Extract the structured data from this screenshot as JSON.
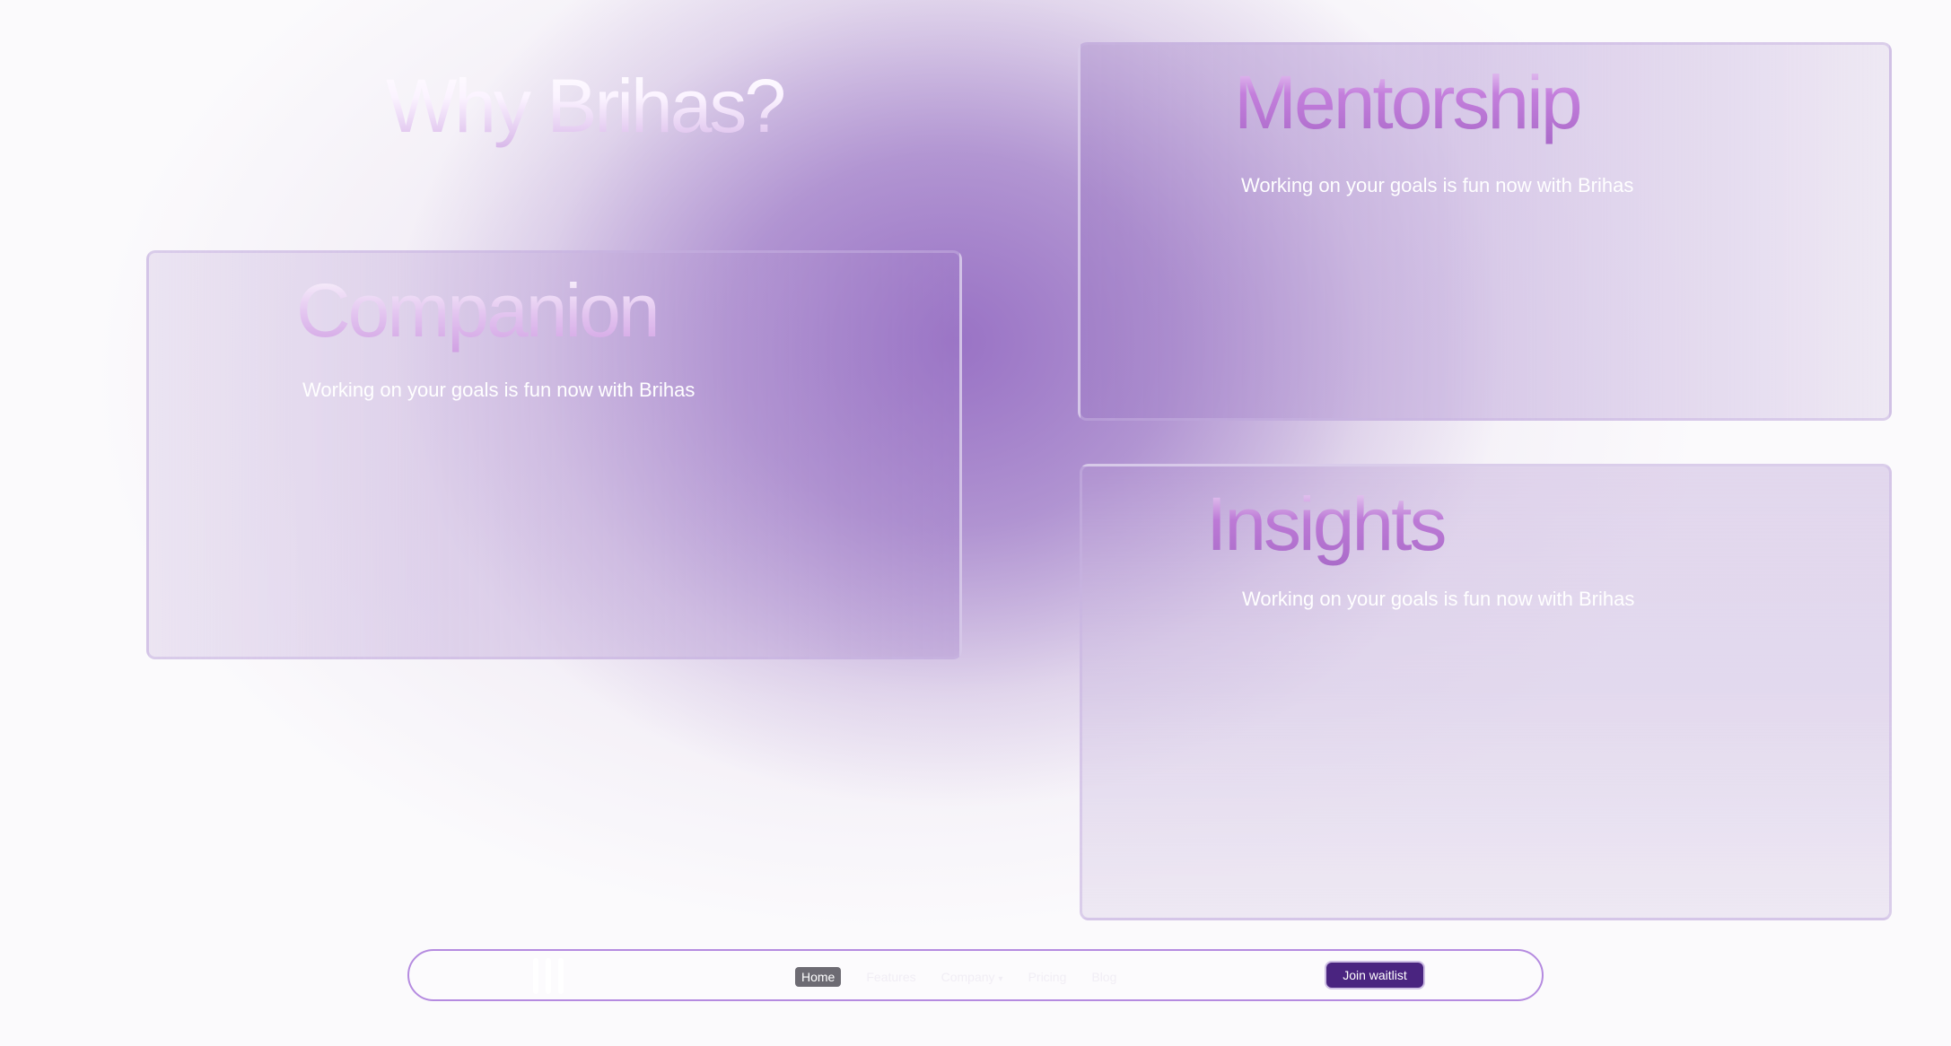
{
  "headline": "Why Brihas?",
  "cards": {
    "mentorship": {
      "title": "Mentorship",
      "text": "Working on your goals is fun now with Brihas"
    },
    "companion": {
      "title": "Companion",
      "text": "Working on your goals is fun now with Brihas"
    },
    "insights": {
      "title": "Insights",
      "text": "Working on your goals is fun now with Brihas"
    }
  },
  "navbar": {
    "logo_icon": "three-vertical-bars",
    "links": [
      {
        "label": "Home",
        "active": true
      },
      {
        "label": "Features",
        "active": false
      },
      {
        "label": "Company",
        "active": false,
        "has_dropdown": true
      },
      {
        "label": "Pricing",
        "active": false
      },
      {
        "label": "Blog",
        "active": false
      }
    ],
    "cta": "Join waitlist"
  },
  "colors": {
    "accent_purple": "#a868c8",
    "button_bg": "#4a2480",
    "nav_border": "#b58be0"
  }
}
